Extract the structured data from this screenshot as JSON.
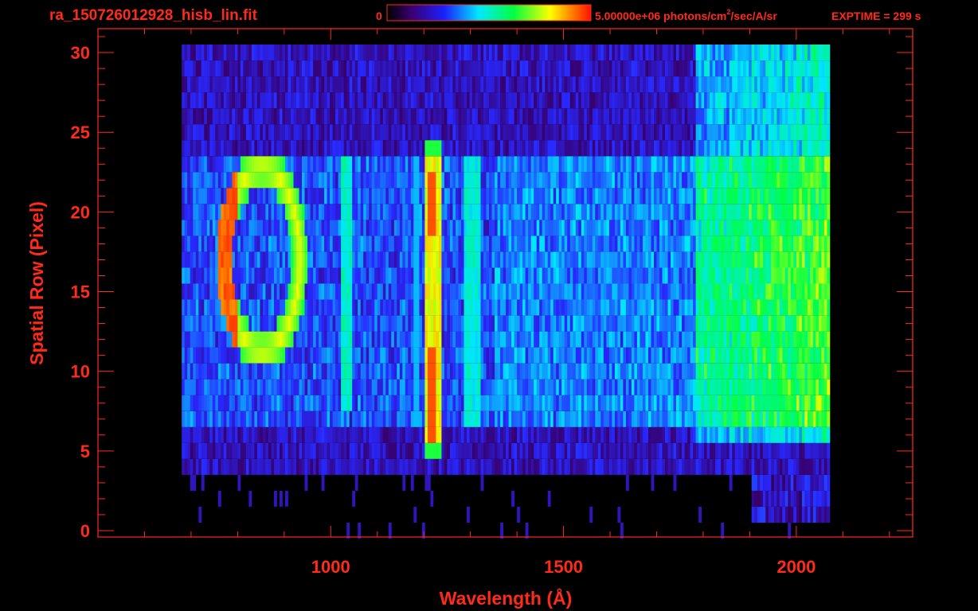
{
  "header": {
    "filename": "ra_150726012928_hisb_lin.fit",
    "colorbar_min": "0",
    "colorbar_max": "5.00000e+06",
    "units_pre": "photons/cm",
    "units_sup": "2",
    "units_post": "/sec/A/sr",
    "exptime": "EXPTIME = 299 s"
  },
  "colors": {
    "text": "#ff2a1a",
    "axis": "#ff2a1a",
    "background": "#000000"
  },
  "chart_data": {
    "type": "heatmap",
    "title": "ra_150726012928_hisb_lin.fit",
    "xlabel": "Wavelength (Å)",
    "ylabel": "Spatial Row (Pixel)",
    "xlim": [
      500,
      2250
    ],
    "ylim": [
      -0.4,
      31.5
    ],
    "x_ticks": [
      1000,
      1500,
      2000
    ],
    "y_ticks": [
      0,
      5,
      10,
      15,
      20,
      25,
      30
    ],
    "colorscale": "rainbow",
    "z_range": [
      0,
      5000000
    ],
    "data_extent": {
      "x": [
        680,
        2070
      ],
      "y": [
        4,
        30
      ]
    },
    "features": [
      {
        "kind": "emission_line",
        "x_center": 1216,
        "y_range": [
          5,
          24
        ],
        "peak_rows": [
          6,
          7,
          8,
          9,
          10,
          11,
          20,
          21,
          22
        ]
      },
      {
        "kind": "ring",
        "x_center": 850,
        "y_center": 17,
        "x_radius": 85,
        "y_radius": 6
      },
      {
        "kind": "continuum",
        "x_range": [
          1780,
          2070
        ],
        "y_range": [
          6,
          30
        ]
      },
      {
        "kind": "faint_line",
        "x_center": 1030,
        "y_range": [
          8,
          23
        ]
      },
      {
        "kind": "faint_line",
        "x_center": 1300,
        "y_range": [
          7,
          23
        ]
      }
    ]
  }
}
